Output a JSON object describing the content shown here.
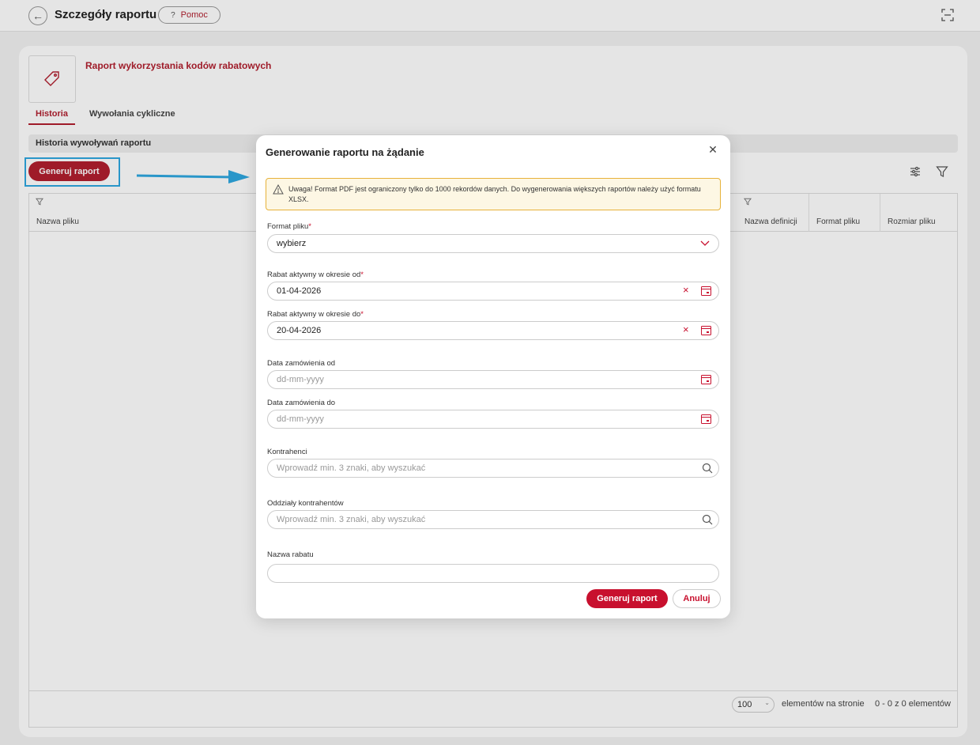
{
  "header": {
    "title": "Szczegóły raportu",
    "help_label": "Pomoc",
    "help_icon": "?"
  },
  "report": {
    "title": "Raport wykorzystania kodów rabatowych",
    "tabs": [
      "Historia",
      "Wywołania cykliczne"
    ],
    "section_title": "Historia wywoływań raportu",
    "generate_label": "Generuj raport"
  },
  "table": {
    "columns": [
      "Nazwa pliku",
      "Nazwa definicji",
      "Format pliku",
      "Rozmiar pliku"
    ],
    "per_page": "100",
    "per_page_label": "elementów na stronie",
    "range_label": "0 - 0 z 0 elementów"
  },
  "modal": {
    "title": "Generowanie raportu na żądanie",
    "warning": "Uwaga! Format PDF jest ograniczony tylko do 1000 rekordów danych. Do wygenerowania większych raportów należy użyć formatu XLSX.",
    "fields": {
      "format": {
        "label": "Format pliku",
        "value": "wybierz"
      },
      "active_from": {
        "label": "Rabat aktywny w okresie od",
        "value": "01-04-2026"
      },
      "active_to": {
        "label": "Rabat aktywny w okresie do",
        "value": "20-04-2026"
      },
      "order_from": {
        "label": "Data zamówienia od",
        "placeholder": "dd-mm-yyyy"
      },
      "order_to": {
        "label": "Data zamówienia do",
        "placeholder": "dd-mm-yyyy"
      },
      "contractors": {
        "label": "Kontrahenci",
        "placeholder": "Wprowadź min. 3 znaki, aby wyszukać"
      },
      "branches": {
        "label": "Oddziały kontrahentów",
        "placeholder": "Wprowadź min. 3 znaki, aby wyszukać"
      },
      "discount_name": {
        "label": "Nazwa rabatu",
        "value": ""
      }
    },
    "required_mark": "*",
    "submit_label": "Generuj raport",
    "cancel_label": "Anuluj"
  },
  "colors": {
    "accent": "#c8102e",
    "highlight": "#2ea8e0",
    "warning_bg": "#fdf7e4",
    "warning_border": "#e7b23a"
  }
}
